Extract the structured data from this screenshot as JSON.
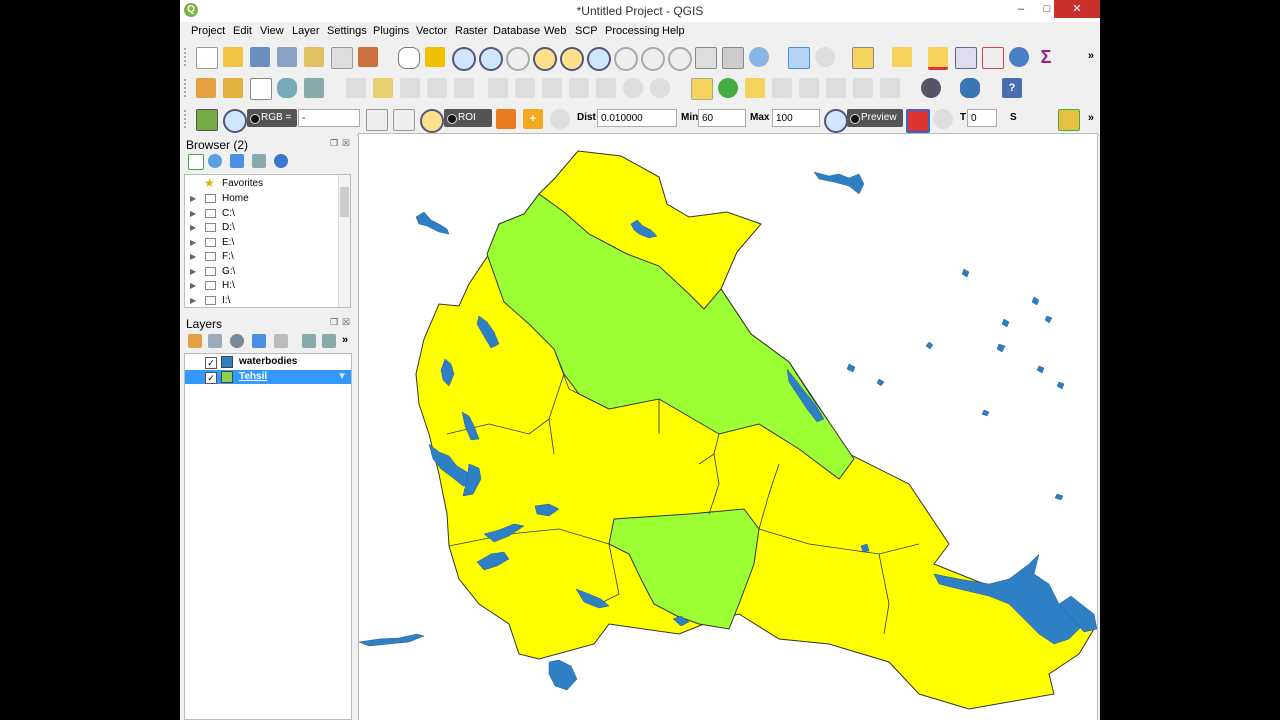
{
  "window": {
    "title": "*Untitled Project - QGIS",
    "app_icon_letter": "Q",
    "controls": {
      "minimize": "–",
      "maximize": "□",
      "close": "✕"
    }
  },
  "menubar": {
    "items": [
      "Project",
      "Edit",
      "View",
      "Layer",
      "Settings",
      "Plugins",
      "Vector",
      "Raster",
      "Database",
      "Web",
      "SCP",
      "Processing",
      "Help"
    ]
  },
  "toolbar": {
    "overflow": "»"
  },
  "scp_toolbar": {
    "band_set_label": "RGB =",
    "band_combo_value": "-",
    "roi_label": "ROI",
    "dist_label": "Dist",
    "dist_value": "0.010000",
    "min_label": "Min",
    "min_value": "60",
    "max_label": "Max",
    "max_value": "100",
    "preview_label": "Preview",
    "t_label": "T",
    "t_value": "0",
    "s_label": "S"
  },
  "browser_panel": {
    "title": "Browser (2)",
    "items": [
      {
        "label": "Favorites",
        "icon": "star-icon"
      },
      {
        "label": "Home",
        "icon": "home-icon"
      },
      {
        "label": "C:\\",
        "icon": "folder-icon"
      },
      {
        "label": "D:\\",
        "icon": "folder-icon"
      },
      {
        "label": "E:\\",
        "icon": "folder-icon"
      },
      {
        "label": "F:\\",
        "icon": "folder-icon"
      },
      {
        "label": "G:\\",
        "icon": "folder-icon"
      },
      {
        "label": "H:\\",
        "icon": "folder-icon"
      },
      {
        "label": "I:\\",
        "icon": "folder-icon"
      }
    ]
  },
  "layers_panel": {
    "title": "Layers",
    "layers": [
      {
        "label": "waterbodies",
        "checked": "✓",
        "color": "#2f7fc4",
        "selected": false
      },
      {
        "label": "Tehsil",
        "checked": "✓",
        "color": "#8fd14f",
        "selected": true
      }
    ]
  },
  "colors": {
    "yellow_region": "#ffff00",
    "green_region": "#9bff33",
    "water": "#2f7fc4",
    "selection": "#3399ff"
  }
}
